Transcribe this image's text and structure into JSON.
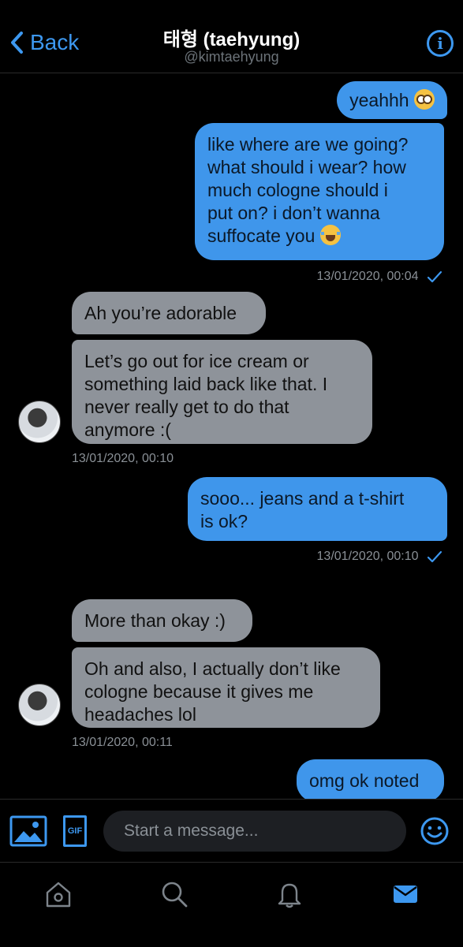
{
  "header": {
    "back_label": "Back",
    "title": "태형 (taehyung)",
    "handle": "@kimtaehyung"
  },
  "messages": [
    {
      "type": "out",
      "text": "yeahhh",
      "emoji": "flushed-face"
    },
    {
      "type": "out",
      "text": "like where are we going? what should i wear? how much cologne should i put on? i don’t wanna suffocate you",
      "emoji": "loudly-crying-face",
      "lines": [
        "like where are we going?",
        "what should i wear? how",
        "much cologne should i",
        "put on? i don’t wanna",
        "suffocate you"
      ]
    },
    {
      "type": "timestamp_out",
      "text": "13/01/2020, 00:04"
    },
    {
      "type": "in",
      "text": "Ah you’re adorable"
    },
    {
      "type": "in",
      "text": "Let’s go out for ice cream or something laid back like that. I never really get to do that anymore :(",
      "lines": [
        "Let’s go out for ice cream or",
        "something laid back like that. I",
        "never really get to do that",
        "anymore :("
      ]
    },
    {
      "type": "timestamp_in",
      "text": "13/01/2020, 00:10"
    },
    {
      "type": "out",
      "text": "sooo... jeans and a t-shirt is ok?",
      "lines": [
        "sooo... jeans and a t-shirt",
        "is ok?"
      ]
    },
    {
      "type": "timestamp_out",
      "text": "13/01/2020, 00:10"
    },
    {
      "type": "in",
      "text": "More than okay :)"
    },
    {
      "type": "in",
      "text": "Oh and also, I actually don’t like cologne because it gives me headaches lol",
      "lines": [
        "Oh and also, I actually don’t like",
        "cologne because it gives me",
        "headaches lol"
      ]
    },
    {
      "type": "timestamp_in",
      "text": "13/01/2020, 00:11"
    },
    {
      "type": "out",
      "text": "omg ok noted"
    }
  ],
  "composer": {
    "placeholder": "Start a message...",
    "gif_label": "GIF"
  },
  "colors": {
    "accent": "#3d98f0",
    "outgoing_bubble": "#3f96eb",
    "incoming_bubble": "#8e939a",
    "background": "#000000"
  },
  "tabs": [
    "home-icon",
    "search-icon",
    "notifications-icon",
    "messages-icon"
  ]
}
